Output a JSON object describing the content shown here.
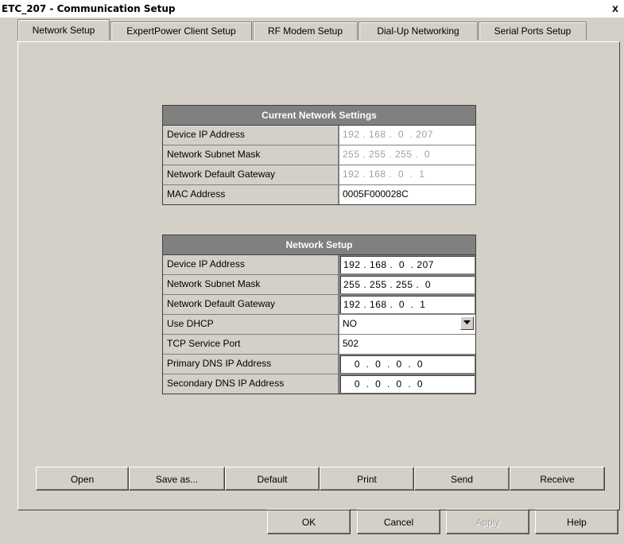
{
  "window": {
    "title": "ETC_207 - Communication Setup",
    "close": "x"
  },
  "tabs": [
    {
      "label": "Network Setup",
      "active": true
    },
    {
      "label": "ExpertPower Client Setup",
      "active": false
    },
    {
      "label": "RF Modem Setup",
      "active": false
    },
    {
      "label": "Dial-Up Networking",
      "active": false
    },
    {
      "label": "Serial Ports Setup",
      "active": false
    }
  ],
  "current_settings": {
    "header": "Current Network Settings",
    "rows": [
      {
        "label": "Device IP Address",
        "value": "192 . 168 .  0  . 207"
      },
      {
        "label": "Network Subnet Mask",
        "value": "255 . 255 . 255 .  0"
      },
      {
        "label": "Network Default Gateway",
        "value": "192 . 168 .  0  .  1"
      },
      {
        "label": "MAC Address",
        "value": "0005F000028C"
      }
    ]
  },
  "network_setup": {
    "header": "Network Setup",
    "rows": [
      {
        "label": "Device IP Address",
        "value": "192 . 168 .  0  . 207"
      },
      {
        "label": "Network Subnet Mask",
        "value": "255 . 255 . 255 .  0"
      },
      {
        "label": "Network Default Gateway",
        "value": "192 . 168 .  0  .  1"
      },
      {
        "label": "Use DHCP",
        "value": "NO"
      },
      {
        "label": "TCP Service Port",
        "value": "502"
      },
      {
        "label": "Primary DNS IP Address",
        "value": " 0  .  0  .  0  .  0"
      },
      {
        "label": "Secondary DNS IP Address",
        "value": " 0  .  0  .  0  .  0"
      }
    ]
  },
  "action_buttons": {
    "open": "Open",
    "save_as": "Save as...",
    "default": "Default",
    "print": "Print",
    "send": "Send",
    "receive": "Receive"
  },
  "dialog_buttons": {
    "ok": "OK",
    "cancel": "Cancel",
    "apply": "Apply",
    "help": "Help"
  },
  "colors": {
    "face": "#d4d0c8",
    "header_bg": "#808080",
    "disabled_text": "#a0a0a0"
  },
  "icons": {
    "dropdown": "chevron-down-icon",
    "close": "close-icon"
  }
}
